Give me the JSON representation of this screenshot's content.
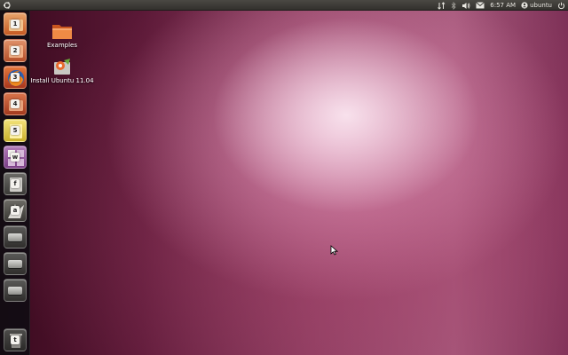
{
  "top_panel": {
    "clock": "6:57 AM",
    "user": "ubuntu",
    "icons": [
      "dash-logo-icon",
      "network-icon",
      "bluetooth-icon",
      "volume-icon",
      "mail-icon",
      "user-icon",
      "power-icon"
    ]
  },
  "launcher": {
    "items": [
      {
        "shortcut": "1",
        "icon": "home-folder-icon"
      },
      {
        "shortcut": "2",
        "icon": "apps-icon"
      },
      {
        "shortcut": "3",
        "icon": "firefox-icon"
      },
      {
        "shortcut": "4",
        "icon": "install-icon"
      },
      {
        "shortcut": "5",
        "icon": "notes-icon"
      },
      {
        "shortcut": "w",
        "icon": "workspace-switcher-icon"
      },
      {
        "shortcut": "f",
        "icon": "files-icon"
      },
      {
        "shortcut": "a",
        "icon": "applications-icon"
      },
      {
        "icon": "drive-icon"
      },
      {
        "icon": "drive-icon"
      },
      {
        "icon": "drive-icon"
      },
      {
        "shortcut": "t",
        "icon": "trash-icon"
      }
    ]
  },
  "desktop": {
    "icons": [
      {
        "label": "Examples",
        "icon": "folder-icon"
      },
      {
        "label": "Install Ubuntu 11.04",
        "icon": "installer-icon"
      }
    ]
  },
  "colors": {
    "panel": "#3c3b37",
    "launcher_bg": "#1a1418",
    "wallpaper_accent": "#a45a7c"
  }
}
